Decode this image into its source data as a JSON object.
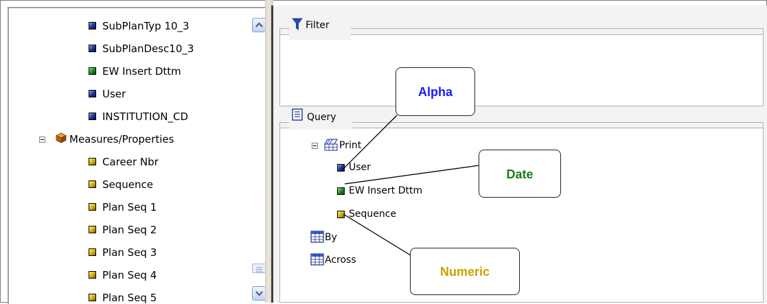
{
  "tree": {
    "items": [
      {
        "label": "SubPlanTyp 10_3",
        "color": "blue"
      },
      {
        "label": "SubPlanDesc10_3",
        "color": "blue"
      },
      {
        "label": "EW Insert Dttm",
        "color": "green"
      },
      {
        "label": "User",
        "color": "blue"
      },
      {
        "label": "INSTITUTION_CD",
        "color": "blue"
      }
    ],
    "measures_label": "Measures/Properties",
    "measures": [
      {
        "label": "Career Nbr"
      },
      {
        "label": "Sequence"
      },
      {
        "label": "Plan Seq 1"
      },
      {
        "label": "Plan Seq 2"
      },
      {
        "label": "Plan Seq 3"
      },
      {
        "label": "Plan Seq 4"
      },
      {
        "label": "Plan Seq 5"
      }
    ]
  },
  "filter": {
    "title": "Filter"
  },
  "query": {
    "title": "Query",
    "print_label": "Print",
    "print_items": [
      {
        "label": "User",
        "color": "blue"
      },
      {
        "label": "EW Insert Dttm",
        "color": "green"
      },
      {
        "label": "Sequence",
        "color": "yellow"
      }
    ],
    "by_label": "By",
    "across_label": "Across"
  },
  "callouts": {
    "alpha": "Alpha",
    "date": "Date",
    "numeric": "Numeric"
  },
  "colors": {
    "alpha": "#1a1aff",
    "date": "#1a7a1a",
    "numeric": "#c9a000"
  }
}
